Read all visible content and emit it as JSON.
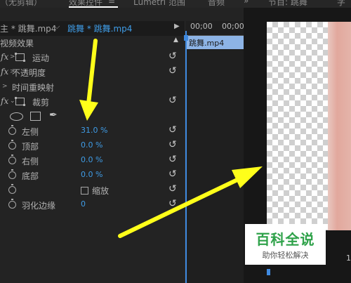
{
  "tabs": {
    "source": "（无剪辑）",
    "effect_controls": "效果控件",
    "menu_icon": "≡",
    "lumetri": "Lumetri 范围",
    "audio": "音频",
    "overflow": "»",
    "program": "节目: 跳舞",
    "partial_right": "字"
  },
  "clip_header": {
    "master": "主 * 跳舞.mp4",
    "sequence": "跳舞 * 跳舞.mp4"
  },
  "section_title": "视频效果",
  "effects": [
    {
      "fx": "fx",
      "label": "运动"
    },
    {
      "fx": "fx",
      "label": "不透明度"
    },
    {
      "fx": "",
      "label": "时间重映射"
    },
    {
      "fx": "fx",
      "label": "裁剪"
    }
  ],
  "crop_params": [
    {
      "label": "左侧",
      "value": "31.0 %"
    },
    {
      "label": "顶部",
      "value": "0.0 %"
    },
    {
      "label": "右侧",
      "value": "0.0 %"
    },
    {
      "label": "底部",
      "value": "0.0 %"
    },
    {
      "label": "",
      "value": "缩放"
    },
    {
      "label": "羽化边缘",
      "value": "0"
    }
  ],
  "timeline": {
    "tc_left": "00;00",
    "tc_right": "00;00",
    "clip_label": "跳舞.mp4"
  },
  "monitor": {
    "partial_number": "1"
  },
  "watermark": {
    "title": "百科全说",
    "subtitle": "助你轻松解决"
  },
  "colors": {
    "accent_blue": "#3f9ce6",
    "annotation_yellow": "#ffff1a",
    "watermark_green": "#2fa24a"
  }
}
